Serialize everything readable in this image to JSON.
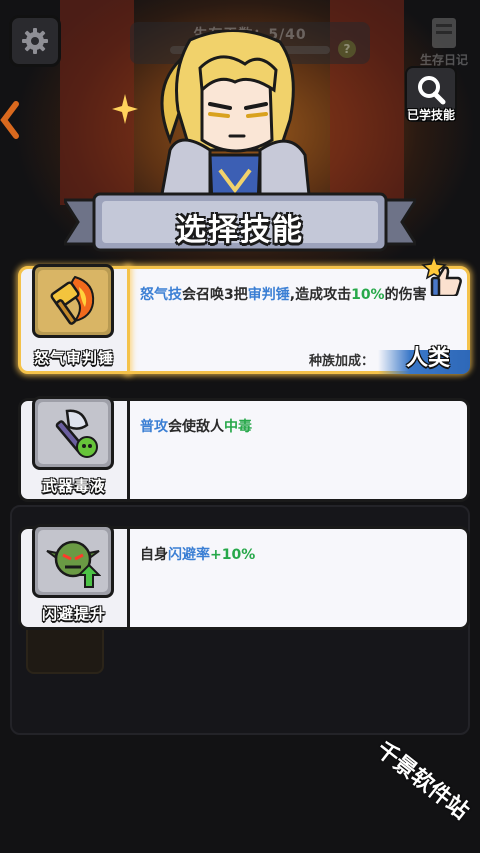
{
  "hud": {
    "progress_label": "生存天数：5/40",
    "diary_label": "生存日记",
    "learned_label": "已学技能"
  },
  "banner": {
    "title": "选择技能"
  },
  "skills": [
    {
      "name": "怒气审判锤",
      "icon": "flaming-hammer-icon",
      "desc": {
        "p1": "怒气技",
        "p2": "会召唤3把",
        "p3": "审判锤",
        "p4": ",造成攻击",
        "p5": "10%",
        "p6": "的伤害"
      },
      "race_label": "种族加成：",
      "race_value": "人类",
      "highlighted": true
    },
    {
      "name": "武器毒液",
      "icon": "poison-axe-icon",
      "desc": {
        "p1": "普攻",
        "p2": "会使敌人",
        "p3": "中毒"
      }
    },
    {
      "name": "闪避提升",
      "icon": "goblin-dodge-icon",
      "desc": {
        "p1": "自身",
        "p2": "闪避率",
        "p3": "+10%"
      }
    }
  ],
  "watermark": "千景软件站",
  "colors": {
    "accent_blue": "#3b7fd4",
    "accent_green": "#27a84a",
    "highlight": "#f4c24a"
  }
}
